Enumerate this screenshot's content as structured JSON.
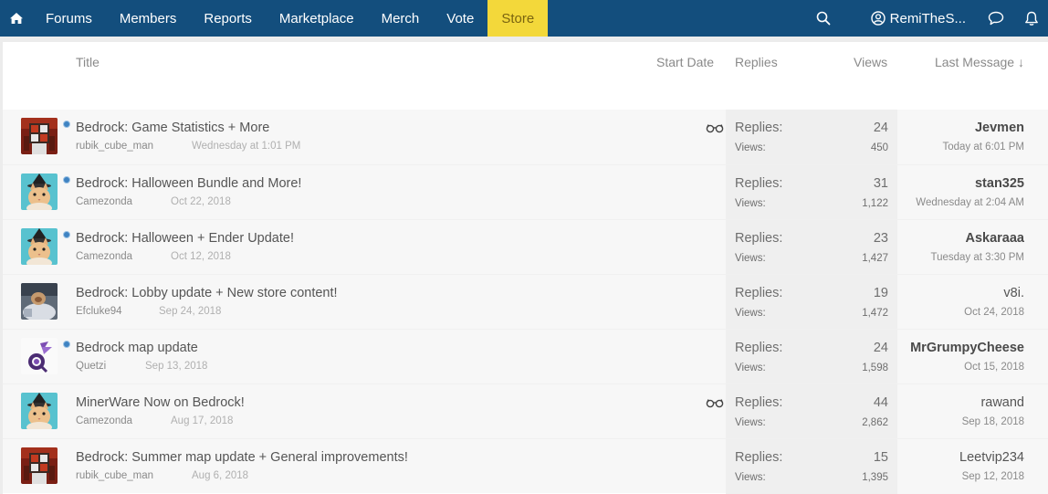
{
  "nav": {
    "items": [
      {
        "label": "Forums"
      },
      {
        "label": "Members"
      },
      {
        "label": "Reports"
      },
      {
        "label": "Marketplace"
      },
      {
        "label": "Merch"
      },
      {
        "label": "Vote"
      }
    ],
    "store_label": "Store",
    "user_label": "RemiTheS...",
    "colors": {
      "bar": "#134e7d",
      "active": "#1d639a",
      "store": "#f3d83a"
    }
  },
  "columns": {
    "title": "Title",
    "start_date": "Start Date",
    "replies": "Replies",
    "views": "Views",
    "last_message": "Last Message ↓"
  },
  "labels": {
    "replies": "Replies:",
    "views": "Views:"
  },
  "threads": [
    {
      "title": "Bedrock: Game Statistics + More",
      "author": "rubik_cube_man",
      "date": "Wednesday at 1:01 PM",
      "replies": "24",
      "views": "450",
      "last_user": "Jevmen",
      "last_date": "Today at 6:01 PM",
      "avatar": "cube",
      "unread": true,
      "watched": true,
      "bold_last": true
    },
    {
      "title": "Bedrock: Halloween Bundle and More!",
      "author": "Camezonda",
      "date": "Oct 22, 2018",
      "replies": "31",
      "views": "1,122",
      "last_user": "stan325",
      "last_date": "Wednesday at 2:04 AM",
      "avatar": "cat",
      "unread": true,
      "watched": false,
      "bold_last": true
    },
    {
      "title": "Bedrock: Halloween + Ender Update!",
      "author": "Camezonda",
      "date": "Oct 12, 2018",
      "replies": "23",
      "views": "1,427",
      "last_user": "Askaraaa",
      "last_date": "Tuesday at 3:30 PM",
      "avatar": "cat",
      "unread": true,
      "watched": false,
      "bold_last": true
    },
    {
      "title": "Bedrock: Lobby update + New store content!",
      "author": "Efcluke94",
      "date": "Sep 24, 2018",
      "replies": "19",
      "views": "1,472",
      "last_user": "v8i.",
      "last_date": "Oct 24, 2018",
      "avatar": "photo",
      "unread": false,
      "watched": false,
      "bold_last": false
    },
    {
      "title": "Bedrock map update",
      "author": "Quetzi",
      "date": "Sep 13, 2018",
      "replies": "24",
      "views": "1,598",
      "last_user": "MrGrumpyCheese",
      "last_date": "Oct 15, 2018",
      "avatar": "emblem",
      "unread": true,
      "watched": false,
      "bold_last": true
    },
    {
      "title": "MinerWare Now on Bedrock!",
      "author": "Camezonda",
      "date": "Aug 17, 2018",
      "replies": "44",
      "views": "2,862",
      "last_user": "rawand",
      "last_date": "Sep 18, 2018",
      "avatar": "cat",
      "unread": false,
      "watched": true,
      "bold_last": false
    },
    {
      "title": "Bedrock: Summer map update + General improvements!",
      "author": "rubik_cube_man",
      "date": "Aug 6, 2018",
      "replies": "15",
      "views": "1,395",
      "last_user": "Leetvip234",
      "last_date": "Sep 12, 2018",
      "avatar": "cube",
      "unread": false,
      "watched": false,
      "bold_last": false
    }
  ]
}
